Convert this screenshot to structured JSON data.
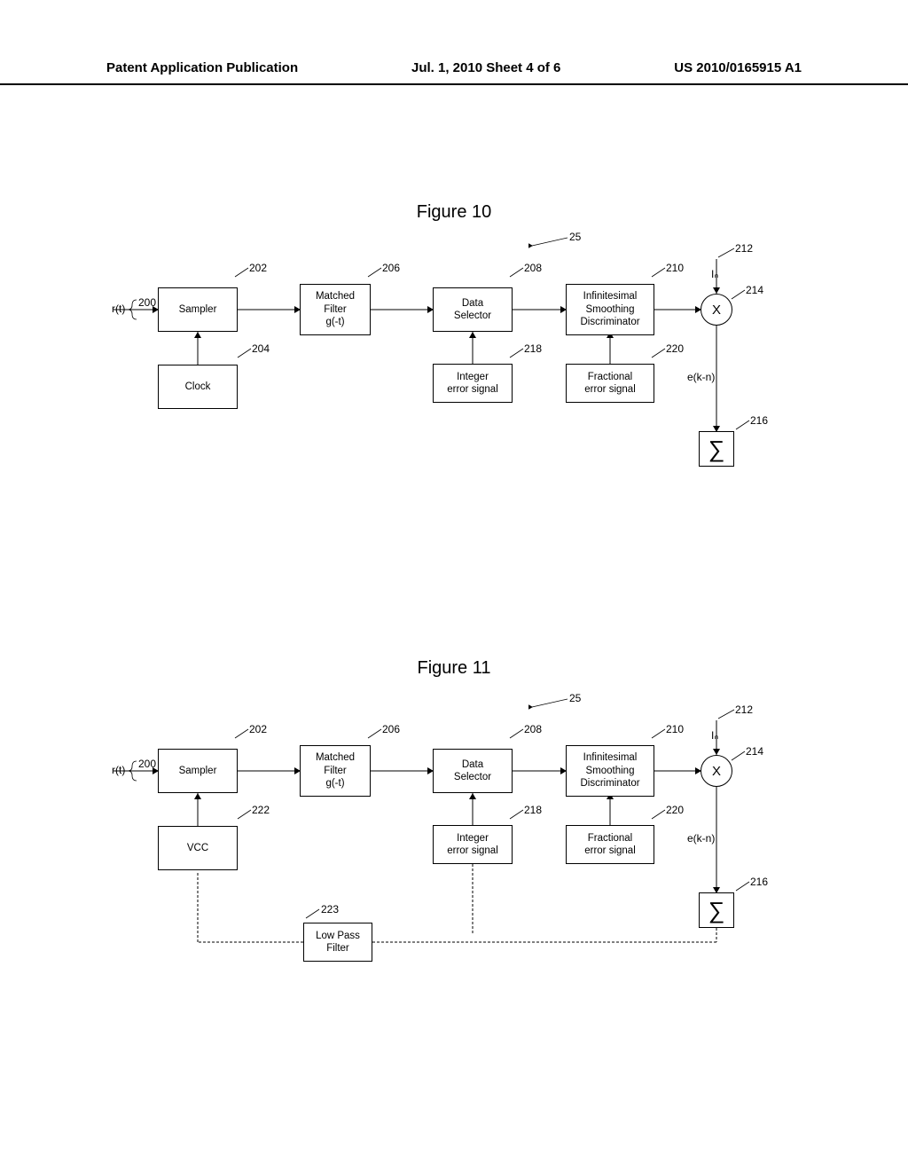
{
  "header": {
    "left": "Patent Application Publication",
    "center": "Jul. 1, 2010  Sheet 4 of 6",
    "right": "US 2010/0165915 A1"
  },
  "fig10": {
    "title": "Figure 10",
    "input": "r(t)",
    "sampler": "Sampler",
    "clock": "Clock",
    "matched": "Matched\nFilter\ng(-t)",
    "dataSel": "Data\nSelector",
    "infSmooth": "Infinitesimal\nSmoothing\nDiscriminator",
    "intErr": "Integer\nerror signal",
    "fracErr": "Fractional\nerror signal",
    "In": "Iₙ",
    "X": "X",
    "sigma": "∑",
    "ek": "e(k-n)",
    "refs": {
      "r200": "200",
      "r202": "202",
      "r204": "204",
      "r206": "206",
      "r208": "208",
      "r210": "210",
      "r212": "212",
      "r214": "214",
      "r216": "216",
      "r218": "218",
      "r220": "220",
      "r25": "25"
    }
  },
  "fig11": {
    "title": "Figure 11",
    "input": "r(t)",
    "sampler": "Sampler",
    "vcc": "VCC",
    "matched": "Matched\nFilter\ng(-t)",
    "dataSel": "Data\nSelector",
    "infSmooth": "Infinitesimal\nSmoothing\nDiscriminator",
    "intErr": "Integer\nerror signal",
    "fracErr": "Fractional\nerror signal",
    "lpf": "Low Pass\nFilter",
    "In": "Iₙ",
    "X": "X",
    "sigma": "∑",
    "ek": "e(k-n)",
    "refs": {
      "r200": "200",
      "r202": "202",
      "r206": "206",
      "r208": "208",
      "r210": "210",
      "r212": "212",
      "r214": "214",
      "r216": "216",
      "r218": "218",
      "r220": "220",
      "r222": "222",
      "r223": "223",
      "r25": "25"
    }
  }
}
